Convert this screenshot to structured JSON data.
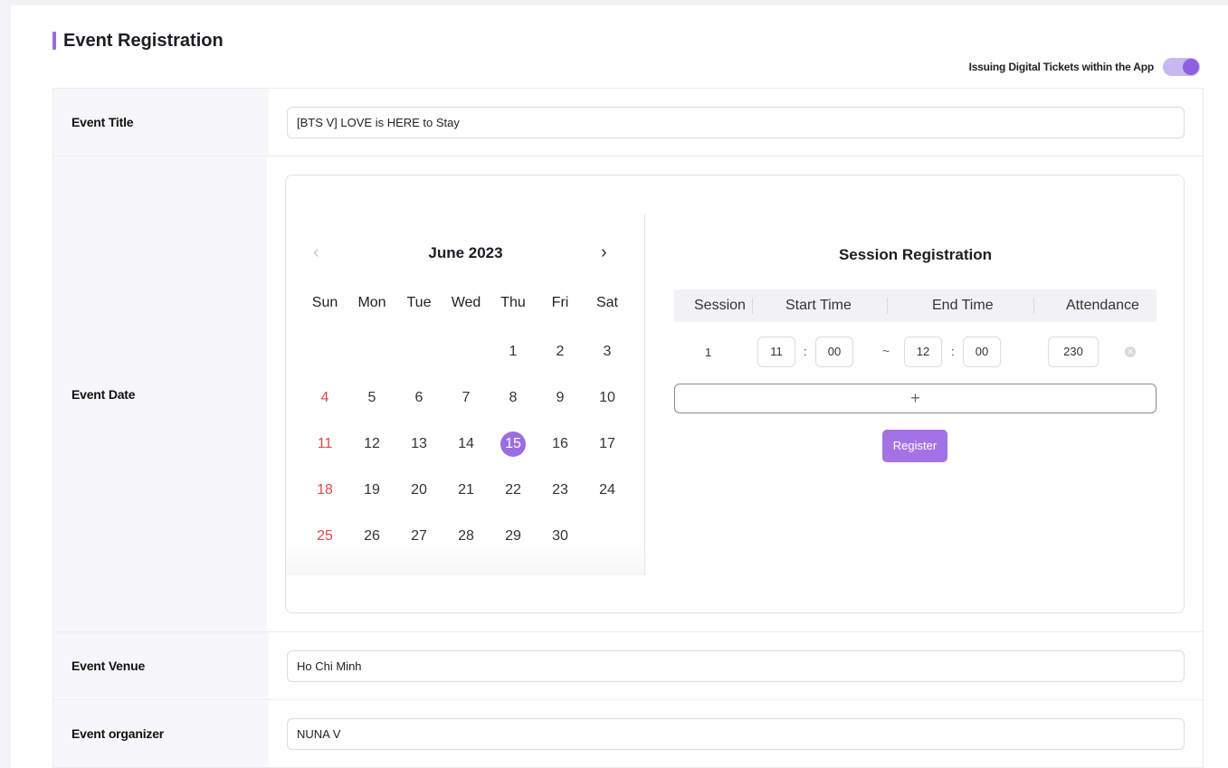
{
  "page": {
    "title": "Event Registration",
    "accent_color": "#9a6ee0"
  },
  "toggle": {
    "label": "Issuing Digital Tickets within the App",
    "on": true
  },
  "form": {
    "title_label": "Event Title",
    "title_value": "[BTS V] LOVE is HERE to Stay",
    "date_label": "Event Date",
    "venue_label": "Event Venue",
    "venue_value": "Ho Chi Minh",
    "organizer_label": "Event organizer",
    "organizer_value": "NUNA V"
  },
  "calendar": {
    "month": "June 2023",
    "prev_icon": "chevron-left-icon",
    "next_icon": "chevron-right-icon",
    "weekdays": [
      "Sun",
      "Mon",
      "Tue",
      "Wed",
      "Thu",
      "Fri",
      "Sat"
    ],
    "weeks": [
      [
        "",
        "",
        "",
        "",
        "1",
        "2",
        "3"
      ],
      [
        "4",
        "5",
        "6",
        "7",
        "8",
        "9",
        "10"
      ],
      [
        "11",
        "12",
        "13",
        "14",
        "15",
        "16",
        "17"
      ],
      [
        "18",
        "19",
        "20",
        "21",
        "22",
        "23",
        "24"
      ],
      [
        "25",
        "26",
        "27",
        "28",
        "29",
        "30",
        ""
      ]
    ],
    "selected": "15",
    "sunday_color": "#e04848"
  },
  "session": {
    "title": "Session Registration",
    "headers": {
      "session": "Session",
      "start": "Start Time",
      "end": "End Time",
      "attendance": "Attendance"
    },
    "rows": [
      {
        "num": "1",
        "start_h": "11",
        "start_m": "00",
        "sep": "~",
        "end_h": "12",
        "end_m": "00",
        "attendance": "230"
      }
    ],
    "add_label": "+",
    "register_label": "Register"
  }
}
